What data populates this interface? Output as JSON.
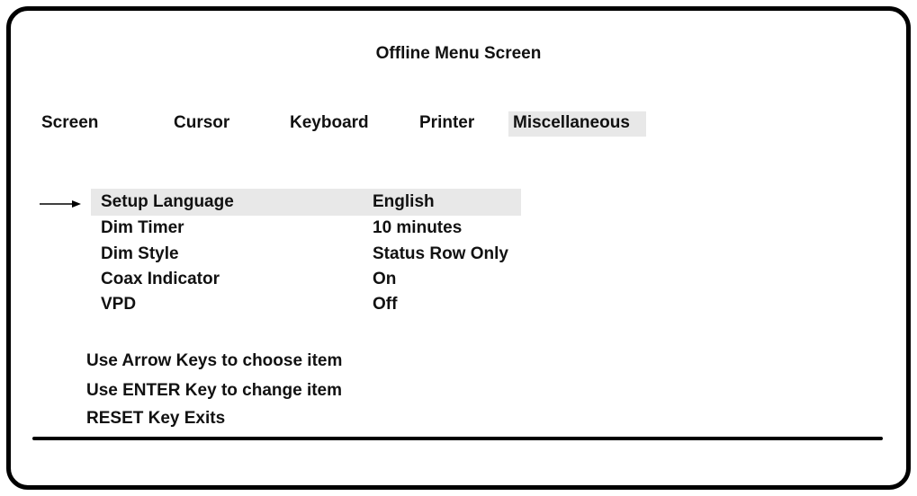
{
  "title": "Offline Menu Screen",
  "tabs": [
    {
      "label": "Screen",
      "selected": false
    },
    {
      "label": "Cursor",
      "selected": false
    },
    {
      "label": "Keyboard",
      "selected": false
    },
    {
      "label": "Printer",
      "selected": false
    },
    {
      "label": "Miscellaneous",
      "selected": true
    }
  ],
  "items": [
    {
      "label": "Setup Language",
      "value": "English",
      "selected": true
    },
    {
      "label": "Dim Timer",
      "value": "10 minutes",
      "selected": false
    },
    {
      "label": "Dim Style",
      "value": "Status Row Only",
      "selected": false
    },
    {
      "label": "Coax Indicator",
      "value": "On",
      "selected": false
    },
    {
      "label": "VPD",
      "value": "Off",
      "selected": false
    }
  ],
  "selection_indicator_icon": "right-arrow-icon",
  "instructions": [
    "Use Arrow Keys to choose item",
    "Use ENTER Key to change item",
    "RESET Key Exits"
  ],
  "colors": {
    "highlight": "#e8e8e8",
    "text": "#111111",
    "frame": "#000000"
  }
}
